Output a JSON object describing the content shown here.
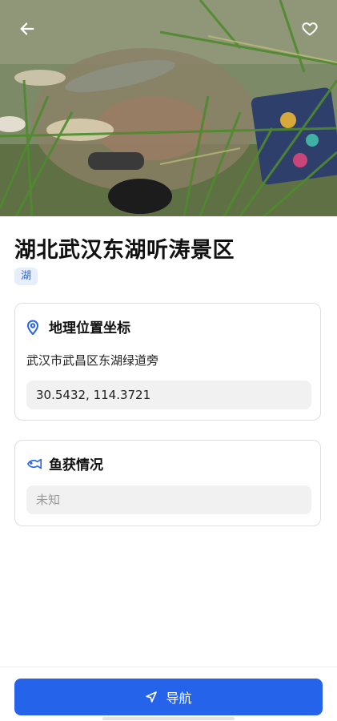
{
  "header": {
    "back_icon": "arrow-left-icon",
    "favorite_icon": "heart-outline-icon",
    "photo_alt": "湖边渔获照片"
  },
  "spot": {
    "title": "湖北武汉东湖听涛景区",
    "tag": "湖"
  },
  "location_card": {
    "icon": "map-pin-icon",
    "title": "地理位置坐标",
    "address": "武汉市武昌区东湖绿道旁",
    "coordinates": "30.5432, 114.3721"
  },
  "catch_card": {
    "icon": "fish-icon",
    "title": "鱼获情况",
    "value": "未知"
  },
  "bottom": {
    "navigate_label": "导航",
    "navigate_icon": "navigation-arrow-icon"
  },
  "colors": {
    "accent": "#2563eb",
    "tag_bg": "#e6eefc",
    "tag_text": "#2f63d8"
  }
}
